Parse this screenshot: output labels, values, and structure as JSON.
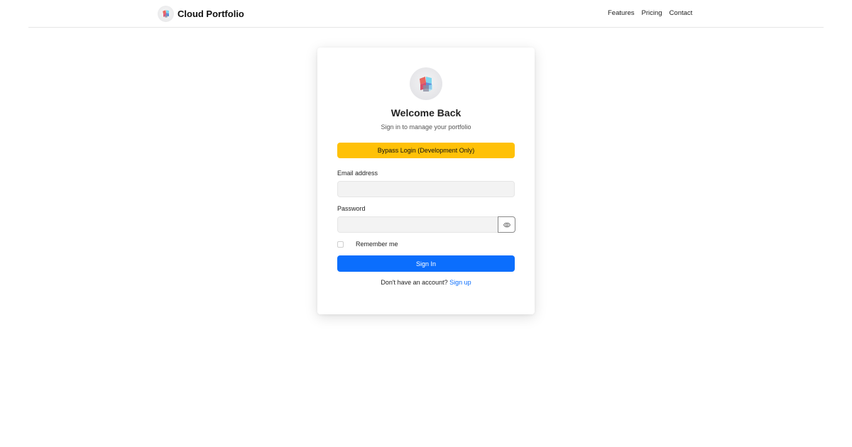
{
  "header": {
    "brand": "Cloud Portfolio",
    "logo_icon": "cube-logo-icon",
    "nav": [
      "Features",
      "Pricing",
      "Contact"
    ]
  },
  "login": {
    "logo_icon": "cube-logo-icon",
    "title": "Welcome Back",
    "subtitle": "Sign in to manage your portfolio",
    "bypass_label": "Bypass Login (Development Only)",
    "email_label": "Email address",
    "email_value": "",
    "email_placeholder": "",
    "password_label": "Password",
    "password_value": "",
    "password_placeholder": "",
    "toggle_icon": "eye-icon",
    "remember_label": "Remember me",
    "remember_checked": false,
    "signin_label": "Sign In",
    "signup_prompt": "Don't have an account?",
    "signup_link": "Sign up"
  },
  "colors": {
    "primary": "#0b6efd",
    "warning": "#ffc107",
    "cube_red": "#e8675f",
    "cube_blue": "#5f8fd9",
    "cube_cyan": "#7fd7ef",
    "cube_gray": "#8b8fa3"
  }
}
